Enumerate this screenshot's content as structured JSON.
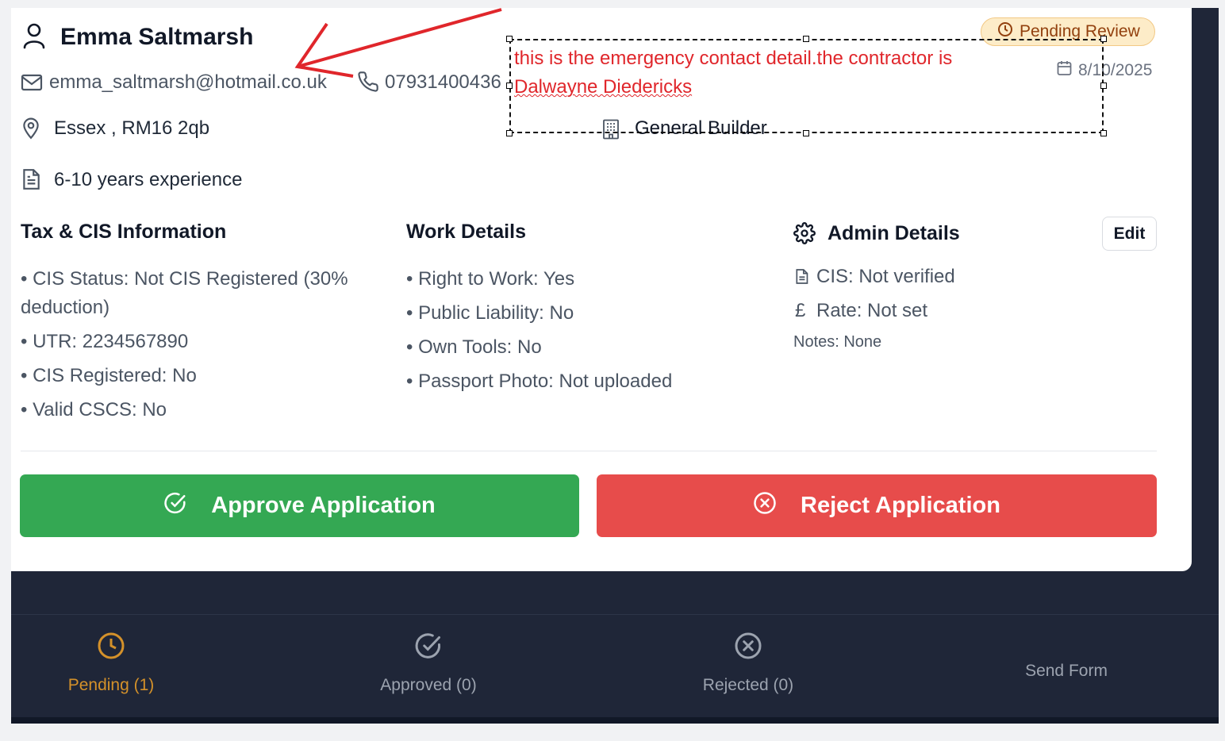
{
  "applicant": {
    "name": "Emma Saltmarsh",
    "email": "emma_saltmarsh@hotmail.co.uk",
    "phone": "07931400436",
    "location": "Essex , RM16 2qb",
    "experience": "6-10 years experience",
    "status": "Pending Review",
    "date": "8/10/2025",
    "trade": "General Builder"
  },
  "tax": {
    "title": "Tax & CIS Information",
    "items": [
      "• CIS Status: Not CIS Registered (30%",
      "deduction)",
      "• UTR: 2234567890",
      "• CIS Registered: No",
      "• Valid CSCS: No"
    ]
  },
  "work": {
    "title": "Work Details",
    "items": [
      "• Right to Work: Yes",
      "• Public Liability: No",
      "• Own Tools: No",
      "• Passport Photo: Not uploaded"
    ]
  },
  "admin": {
    "title": "Admin Details",
    "edit_label": "Edit",
    "cis": "CIS: Not verified",
    "rate_symbol": "£",
    "rate": "Rate: Not set",
    "notes": "Notes: None"
  },
  "actions": {
    "approve": "Approve Application",
    "reject": "Reject Application"
  },
  "annotation": {
    "line1": "this is the emergency contact detail.the contractor is",
    "line2": "Dalwayne Diedericks",
    "color": "#e0262b"
  },
  "nav": {
    "pending": "Pending (1)",
    "approved": "Approved (0)",
    "rejected": "Rejected (0)",
    "send": "Send Form"
  },
  "colors": {
    "approve": "#34a853",
    "reject": "#e74c4b",
    "pending_accent": "#d4912a",
    "nav_bg": "#1f2638",
    "nav_inactive": "#9ca3af"
  },
  "icons": [
    "user-icon",
    "mail-icon",
    "phone-icon",
    "map-pin-icon",
    "document-icon",
    "clock-icon",
    "calendar-icon",
    "building-icon",
    "gear-icon",
    "check-circle-icon",
    "x-circle-icon"
  ]
}
